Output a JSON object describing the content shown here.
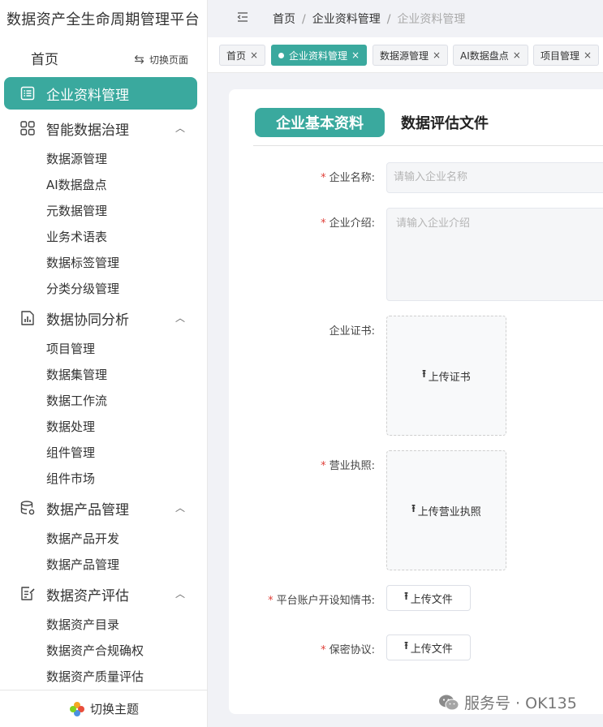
{
  "app": {
    "title": "数据资产全生命周期管理平台"
  },
  "sidebar": {
    "home": "首页",
    "switch_page": "切换页面",
    "active_item": "企业资料管理",
    "groups": [
      {
        "label": "智能数据治理",
        "items": [
          "数据源管理",
          "AI数据盘点",
          "元数据管理",
          "业务术语表",
          "数据标签管理",
          "分类分级管理"
        ]
      },
      {
        "label": "数据协同分析",
        "items": [
          "项目管理",
          "数据集管理",
          "数据工作流",
          "数据处理",
          "组件管理",
          "组件市场"
        ]
      },
      {
        "label": "数据产品管理",
        "items": [
          "数据产品开发",
          "数据产品管理"
        ]
      },
      {
        "label": "数据资产评估",
        "items": [
          "数据资产目录",
          "数据资产合规确权",
          "数据资产质量评估"
        ]
      }
    ],
    "switch_theme": "切换主题"
  },
  "breadcrumb": [
    "首页",
    "企业资料管理",
    "企业资料管理"
  ],
  "tabs": [
    {
      "label": "首页",
      "active": false
    },
    {
      "label": "企业资料管理",
      "active": true
    },
    {
      "label": "数据源管理",
      "active": false
    },
    {
      "label": "AI数据盘点",
      "active": false
    },
    {
      "label": "项目管理",
      "active": false
    }
  ],
  "segments": {
    "active": "企业基本资料",
    "other": "数据评估文件"
  },
  "form": {
    "company_name": {
      "label": "企业名称:",
      "placeholder": "请输入企业名称",
      "required": true
    },
    "company_intro": {
      "label": "企业介绍:",
      "placeholder": "请输入企业介绍",
      "required": true
    },
    "certificate": {
      "label": "企业证书:",
      "button": "上传证书",
      "required": false
    },
    "business_license": {
      "label": "营业执照:",
      "button": "上传营业执照",
      "required": true
    },
    "account_notice": {
      "label": "平台账户开设知情书:",
      "button": "上传文件",
      "required": true
    },
    "confidentiality": {
      "label": "保密协议:",
      "button": "上传文件",
      "required": true
    }
  },
  "watermark": "服务号 · OK135",
  "colors": {
    "accent": "#3aa99e",
    "required": "#e0413a"
  }
}
